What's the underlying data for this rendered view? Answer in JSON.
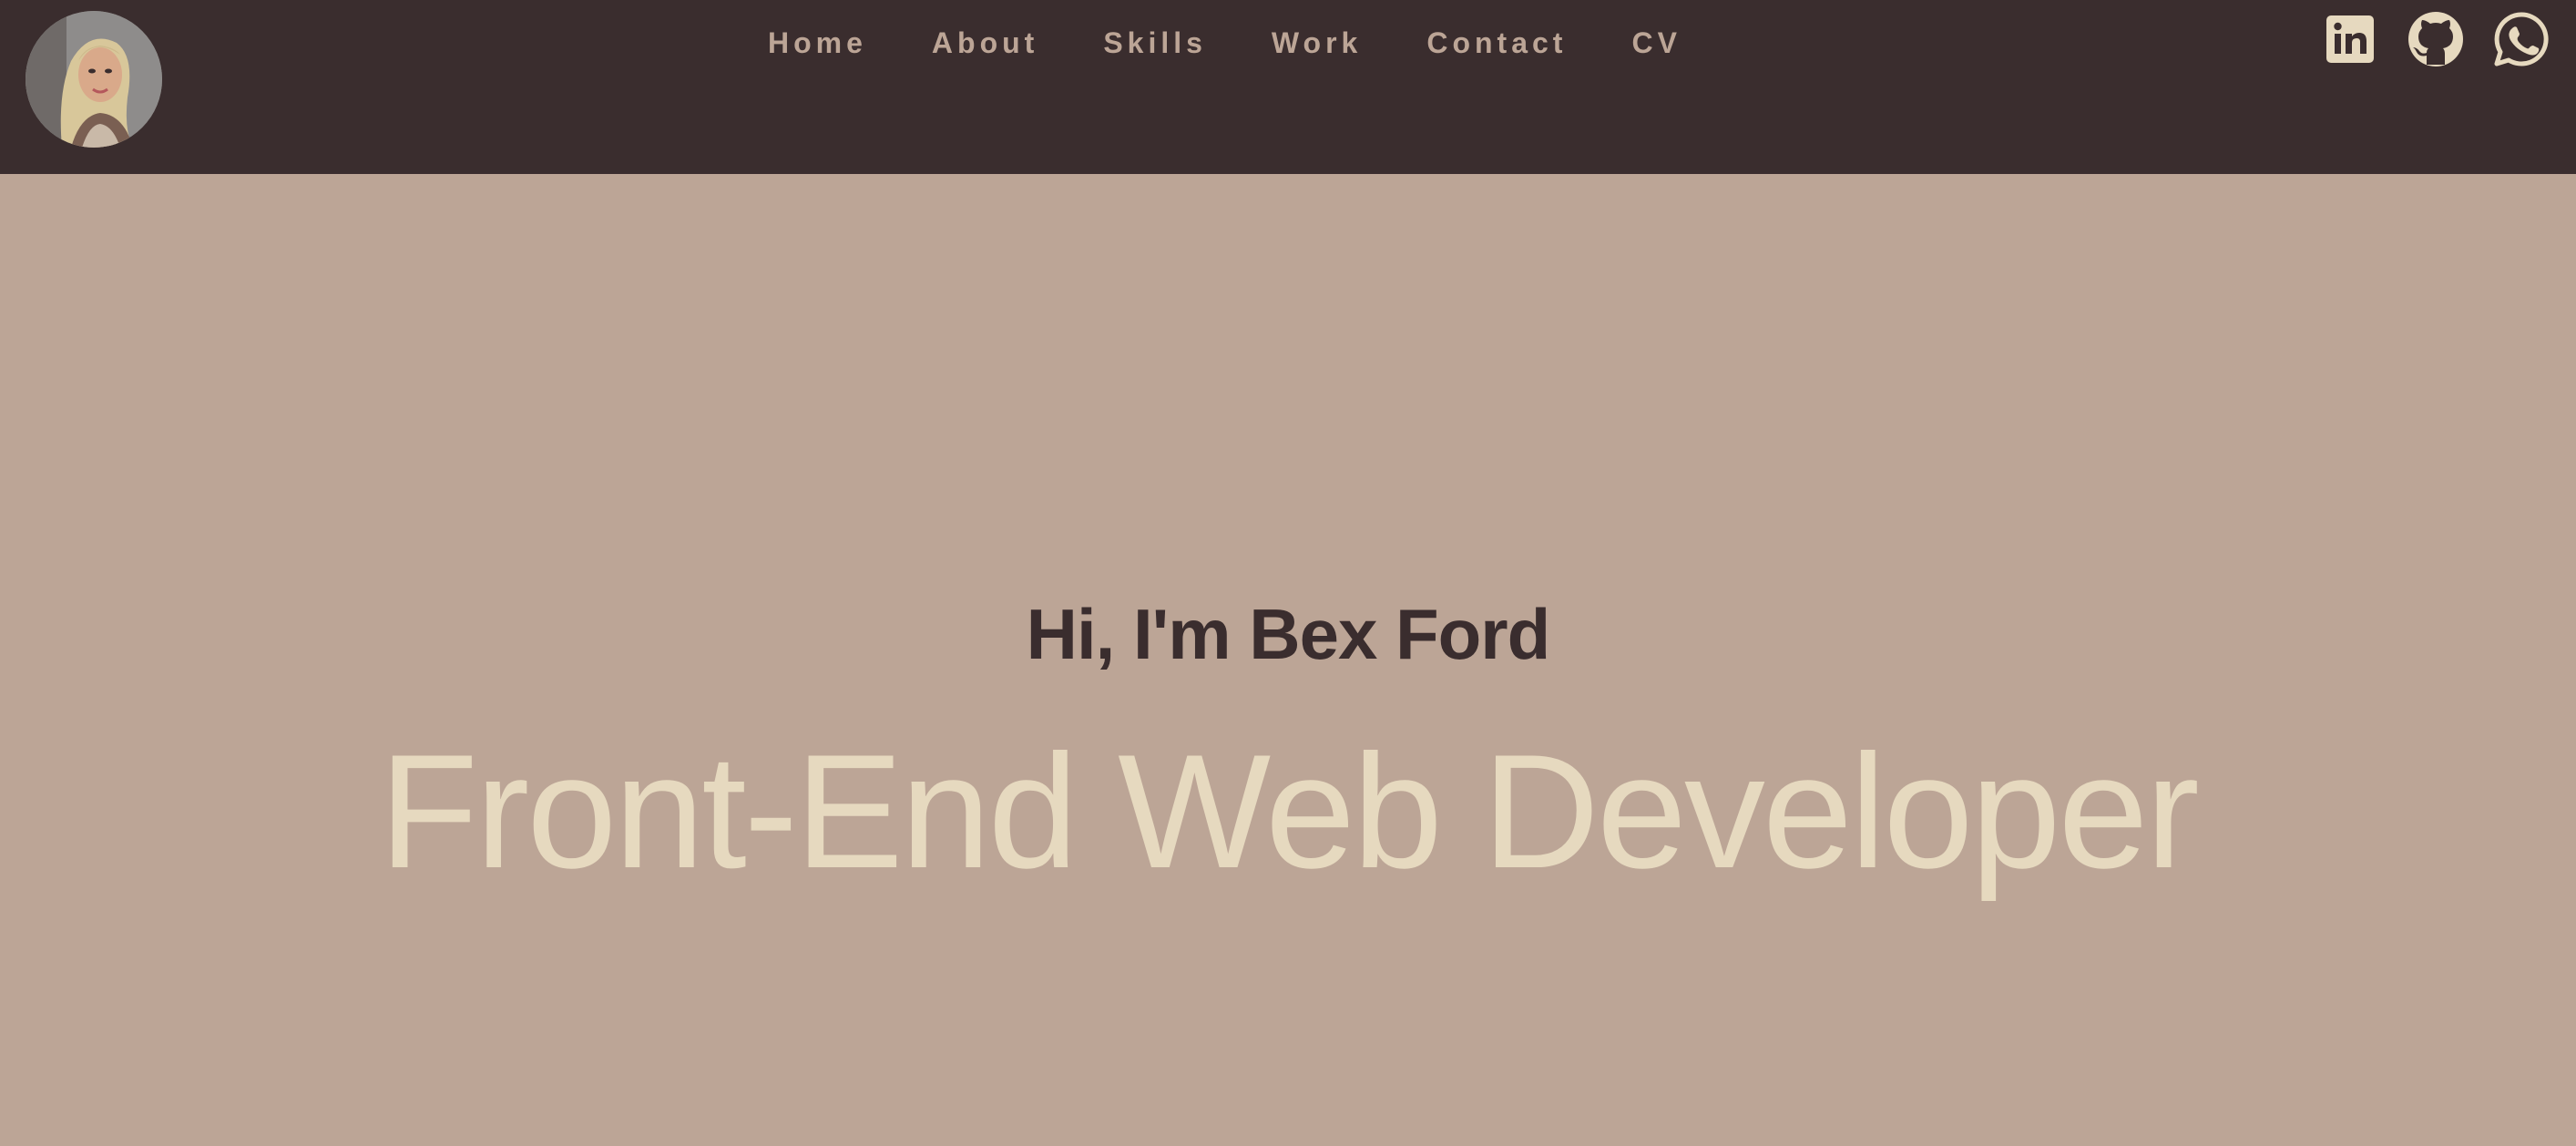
{
  "header": {
    "avatar_alt": "Bex Ford profile photo",
    "nav": [
      {
        "label": "Home"
      },
      {
        "label": "About"
      },
      {
        "label": "Skills"
      },
      {
        "label": "Work"
      },
      {
        "label": "Contact"
      },
      {
        "label": "CV"
      }
    ],
    "social": [
      {
        "name": "linkedin-icon",
        "label": "LinkedIn"
      },
      {
        "name": "github-icon",
        "label": "GitHub"
      },
      {
        "name": "whatsapp-icon",
        "label": "WhatsApp"
      }
    ]
  },
  "hero": {
    "greeting": "Hi, I'm Bex Ford",
    "role": "Front-End Web Developer"
  },
  "colors": {
    "navbar_bg": "#3a2d2e",
    "page_bg": "#bca596",
    "nav_text": "#bca596",
    "icon_color": "#e6d9bf",
    "greeting_color": "#3a2d2e",
    "role_color": "#e6d9bf"
  }
}
